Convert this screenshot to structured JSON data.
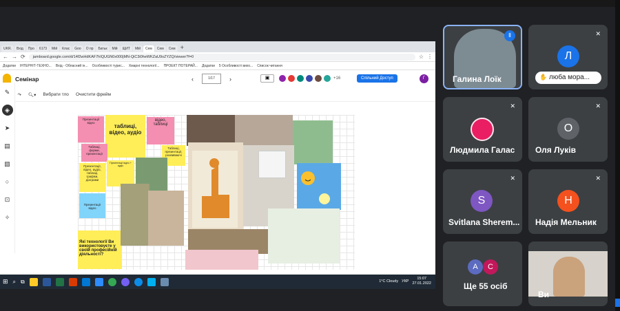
{
  "browser": {
    "tabs": [
      "UKR.",
      "Вхід",
      "Про",
      "6173",
      "Мій",
      "Клас",
      "Goo",
      "О пр",
      "Батьк",
      "Мій",
      "ЩИТ",
      "Мій",
      "Сем",
      "Сем",
      "Сем"
    ],
    "url": "jamboard.google.com/d/14f2wHdKAF7hIQUGN0x000jMN-QiC3i0heWKZaU9oZYZQ/viewer?f=0",
    "bookmarks": [
      "Додатки",
      "ІНТЕРНІТ-ТЕХНО...",
      "Вхід - Обласний ін...",
      "Особливості турис...",
      "Хмарні технології...",
      "ПРОЕКТ ПОТЕРАЙ...",
      "Додатки",
      "5 Особливості вихо...",
      "Список читання"
    ]
  },
  "jamboard": {
    "title": "Семінар",
    "frame_label": "1/17",
    "collab_count": "+16",
    "share_label": "Спільний Доступ",
    "user_initial": "Г",
    "set_bg": "Вибрати тло",
    "clear_frame": "Очистити фрейм"
  },
  "notes": {
    "n1": "Презентації відео",
    "n2": "таблиці, відео, аудіо",
    "n3": "відео, таблиці",
    "n4": "Таблиці, форми, презентації",
    "n5": "Таблиці, презентації, розвиваючі",
    "n6": "Презентації, відео, аудіо, таблиці, графіки, діаграми",
    "n7": "Презентації відео + аудіо",
    "n8": "Презентації відео",
    "n9": "Які технології Ви використовуєте у своїй професійній діяльності?"
  },
  "taskbar": {
    "weather": "1°C Cloudy",
    "lang": "УКР",
    "time": "15:07",
    "date": "27.01.2022"
  },
  "meet": {
    "p1": "Галина Лоїк",
    "p2": "люба мора...",
    "p2_initial": "Л",
    "p3": "Людмила Галас",
    "p4": "Оля Луків",
    "p4_initial": "О",
    "p5": "Svitlana Sherem...",
    "p5_initial": "S",
    "p6": "Надія Мельник",
    "p6_initial": "Н",
    "p7": "Ще 55 осіб",
    "p7_a": "А",
    "p7_c": "С",
    "p8": "Ви"
  },
  "colors": {
    "accent": "#1a73e8",
    "tile": "#3c4043"
  }
}
